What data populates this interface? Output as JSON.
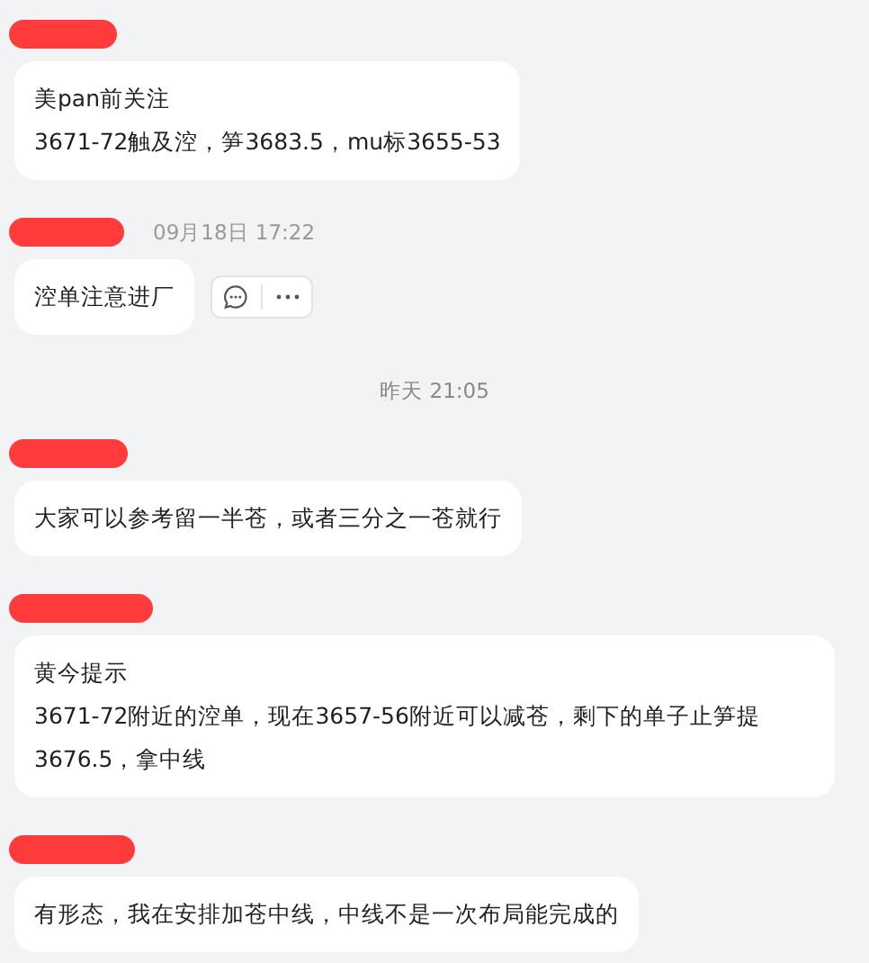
{
  "feed": [
    {
      "kind": "message",
      "sender_redacted": true,
      "lines": [
        "美pan前关注",
        "3671-72触及涳，笋3683.5，mu标3655-53"
      ]
    },
    {
      "kind": "message",
      "sender_redacted": true,
      "time": "09月18日 17:22",
      "lines": [
        "涳单注意进厂"
      ],
      "show_actions": true
    },
    {
      "kind": "divider",
      "time": "昨天 21:05"
    },
    {
      "kind": "message",
      "sender_redacted": true,
      "lines": [
        "大家可以参考留一半苍，或者三分之一苍就行"
      ]
    },
    {
      "kind": "message",
      "sender_redacted": true,
      "lines": [
        "黄今提示",
        "3671-72附近的涳单，现在3657-56附近可以减苍，剩下的单子止笋提3676.5，拿中线"
      ]
    },
    {
      "kind": "message",
      "sender_redacted": true,
      "lines": [
        "有形态，我在安排加苍中线，中线不是一次布局能完成的"
      ]
    }
  ]
}
